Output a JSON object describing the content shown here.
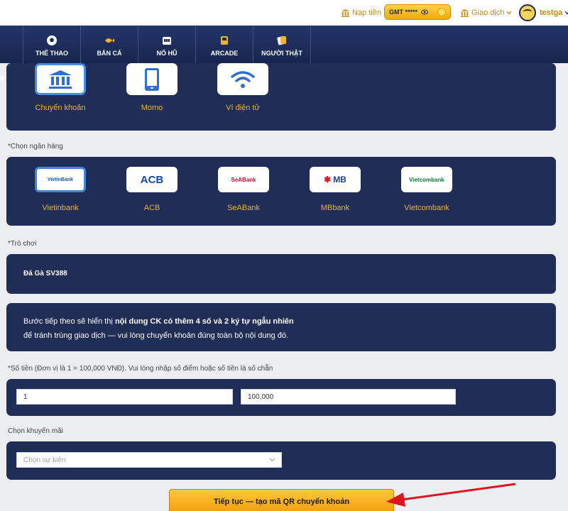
{
  "topbar": {
    "deposit_label": "Nạp tiền",
    "gmt_label": "GMT *****",
    "trade_label": "Giao dịch",
    "username": "testga"
  },
  "nav": {
    "partial_tab": "8",
    "tabs": [
      {
        "label": "THỂ THAO",
        "icon": "soccer-ball-icon"
      },
      {
        "label": "BẮN CÁ",
        "icon": "fish-icon"
      },
      {
        "label": "NỔ HŨ",
        "icon": "slot-machine-icon"
      },
      {
        "label": "ARCADE",
        "icon": "arcade-icon"
      },
      {
        "label": "NGƯỜI THẬT",
        "icon": "playing-cards-icon"
      }
    ]
  },
  "methods": [
    {
      "label": "Chuyển khoản",
      "icon": "bank-building-icon",
      "selected": true
    },
    {
      "label": "Momo",
      "icon": "mobile-phone-icon",
      "selected": false
    },
    {
      "label": "Ví điện tử",
      "icon": "wifi-icon",
      "selected": false
    }
  ],
  "bank_section_label": "*Chọn ngân hàng",
  "banks": [
    {
      "label": "Vietinbank",
      "logo": "VietinBank",
      "selected": true,
      "color": "#1b5aa6"
    },
    {
      "label": "ACB",
      "logo": "ACB",
      "selected": false,
      "color": "#1a4ba0"
    },
    {
      "label": "SeABank",
      "logo": "SeABank",
      "selected": false,
      "color": "#c8102e"
    },
    {
      "label": "MBbank",
      "logo": "MB",
      "selected": false,
      "color": "#1c3d8c"
    },
    {
      "label": "Vietcombank",
      "logo": "Vietcombank",
      "selected": false,
      "color": "#0e7a3c"
    }
  ],
  "game_section_label": "*Trò chơi",
  "game_value": "Đá Gà SV388",
  "note": {
    "prefix": "Bước tiếp theo sẽ hiển thị ",
    "emphasis": "nội dung CK có thêm 4 số và 2 ký tự ngẫu nhiên",
    "line2": "để tránh trùng giao dịch — vui lòng chuyển khoản đúng toàn bộ nội dung đó."
  },
  "amount_section_label": "*Số tiền (Đơn vị là 1 = 100,000 VNĐ). Vui lòng nhập số điểm hoặc số tiền là số chẵn",
  "amount_points": "1",
  "amount_vnd": "100,000",
  "promo_section_label": "Chọn khuyến mãi",
  "promo_placeholder": "Chọn sự kiện",
  "cta_label": "Tiếp tục — tạo mã QR chuyển khoản",
  "colors": {
    "navy": "#1f2d57",
    "accent": "#f0b232",
    "arrow": "#e0141c"
  }
}
